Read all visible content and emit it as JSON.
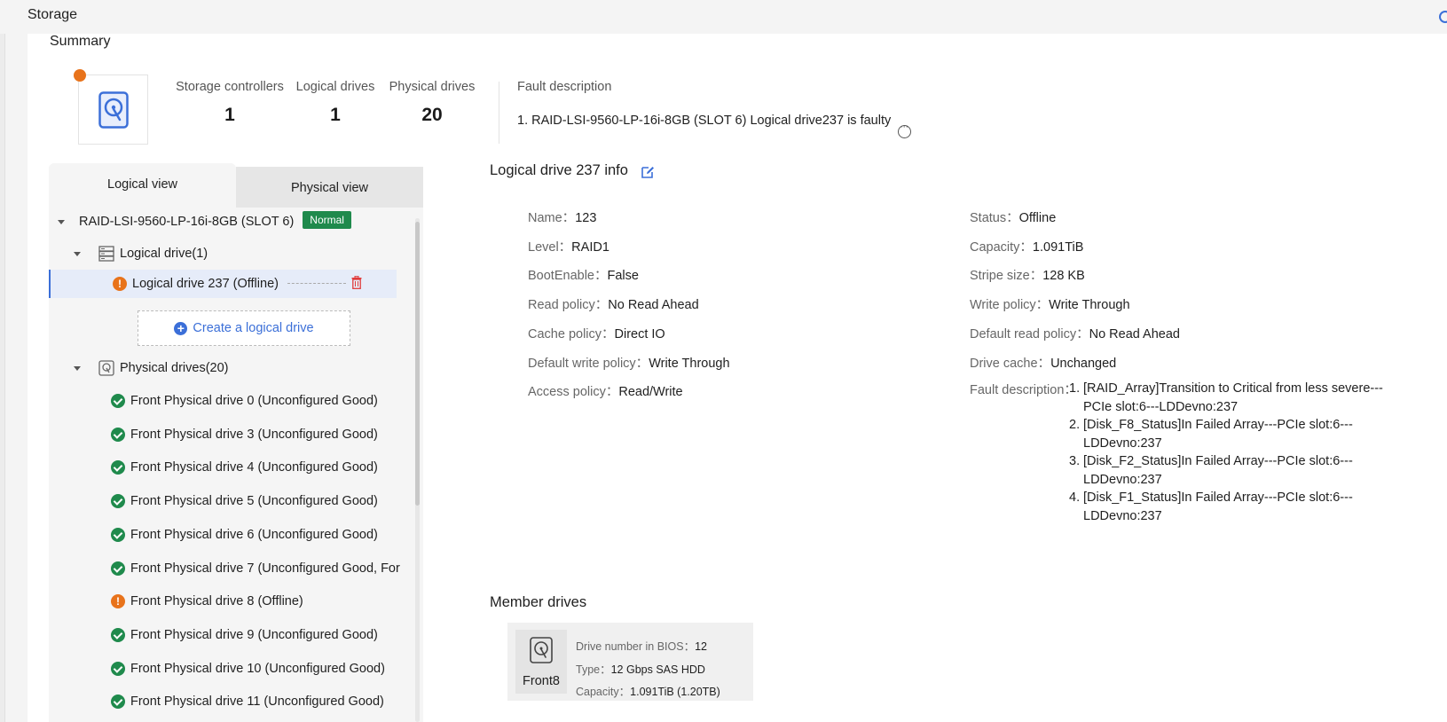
{
  "header": {
    "title": "Storage"
  },
  "summary": {
    "title": "Summary",
    "stats": [
      {
        "label": "Storage controllers",
        "value": "1"
      },
      {
        "label": "Logical drives",
        "value": "1"
      },
      {
        "label": "Physical drives",
        "value": "20"
      }
    ],
    "fault_label": "Fault description",
    "fault_value": "1. RAID-LSI-9560-LP-16i-8GB (SLOT 6) Logical drive237 is faulty"
  },
  "tabs": [
    {
      "label": "Logical view",
      "active": true
    },
    {
      "label": "Physical view",
      "active": false
    }
  ],
  "tree": {
    "controller": {
      "label": "RAID-LSI-9560-LP-16i-8GB (SLOT 6)",
      "badge": "Normal"
    },
    "logical_group": "Logical drive(1)",
    "logical_drive": "Logical drive 237 (Offline)",
    "create_button": "Create a logical drive",
    "physical_group": "Physical drives(20)",
    "physical_drives": [
      {
        "label": "Front Physical drive 0 (Unconfigured Good)",
        "status": "ok"
      },
      {
        "label": "Front Physical drive 3 (Unconfigured Good)",
        "status": "ok"
      },
      {
        "label": "Front Physical drive 4 (Unconfigured Good)",
        "status": "ok"
      },
      {
        "label": "Front Physical drive 5 (Unconfigured Good)",
        "status": "ok"
      },
      {
        "label": "Front Physical drive 6 (Unconfigured Good)",
        "status": "ok"
      },
      {
        "label": "Front Physical drive 7 (Unconfigured Good, For",
        "status": "ok"
      },
      {
        "label": "Front Physical drive 8 (Offline)",
        "status": "warn"
      },
      {
        "label": "Front Physical drive 9 (Unconfigured Good)",
        "status": "ok"
      },
      {
        "label": "Front Physical drive 10 (Unconfigured Good)",
        "status": "ok"
      },
      {
        "label": "Front Physical drive 11 (Unconfigured Good)",
        "status": "ok"
      }
    ]
  },
  "info": {
    "title": "Logical drive 237 info",
    "left": [
      {
        "key": "Name：",
        "value": "123"
      },
      {
        "key": "Level：",
        "value": "RAID1"
      },
      {
        "key": "BootEnable：",
        "value": "False"
      },
      {
        "key": "Read policy：",
        "value": "No Read Ahead"
      },
      {
        "key": "Cache policy：",
        "value": "Direct IO"
      },
      {
        "key": "Default write policy：",
        "value": "Write Through"
      },
      {
        "key": "Access policy：",
        "value": "Read/Write"
      }
    ],
    "right": [
      {
        "key": "Status：",
        "value": "Offline"
      },
      {
        "key": "Capacity：",
        "value": "1.091TiB"
      },
      {
        "key": "Stripe size：",
        "value": "128 KB"
      },
      {
        "key": "Write policy：",
        "value": "Write Through"
      },
      {
        "key": "Default read policy：",
        "value": "No Read Ahead"
      },
      {
        "key": "Drive cache：",
        "value": "Unchanged"
      }
    ],
    "fault_key": "Fault description：",
    "faults": [
      {
        "n": "1.",
        "text": "[RAID_Array]Transition to Critical from less severe---PCIe slot:6---LDDevno:237"
      },
      {
        "n": "2.",
        "text": "[Disk_F8_Status]In Failed Array---PCIe slot:6---LDDevno:237"
      },
      {
        "n": "3.",
        "text": "[Disk_F2_Status]In Failed Array---PCIe slot:6---LDDevno:237"
      },
      {
        "n": "4.",
        "text": "[Disk_F1_Status]In Failed Array---PCIe slot:6---LDDevno:237"
      }
    ]
  },
  "member": {
    "title": "Member drives",
    "card": {
      "label": "Front8",
      "bios_key": "Drive number in BIOS：",
      "bios_value": "12",
      "type_key": "Type：",
      "type_value": "12 Gbps SAS HDD",
      "capacity_key": "Capacity：",
      "capacity_value": "1.091TiB (1.20TB)"
    }
  },
  "colors": {
    "accent": "#3b6fd8",
    "ok": "#1f8a4c",
    "warn": "#e8731b"
  }
}
